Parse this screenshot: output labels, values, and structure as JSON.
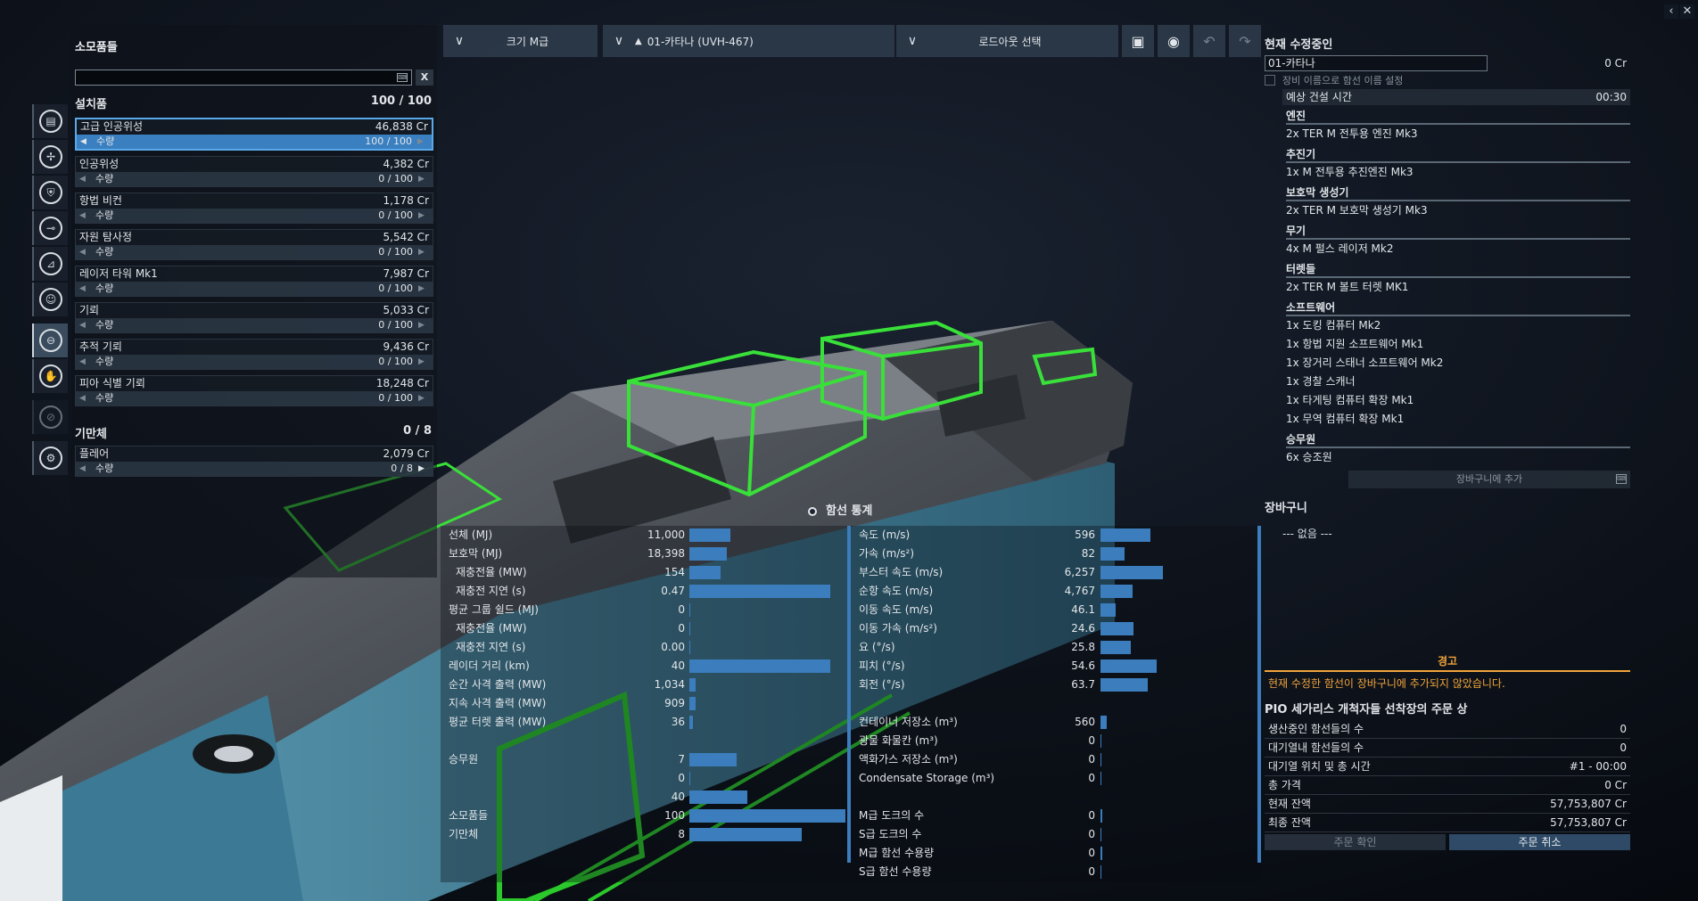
{
  "window": {
    "minimize_icon": "chevron-left-icon",
    "close_icon": "close-icon"
  },
  "topbar": {
    "size_label": "크기 M급",
    "ship_label": "01-카타나 (UVH-467)",
    "loadout_label": "로드아웃 선택",
    "icons": [
      "save-icon",
      "preview-eye-icon",
      "undo-icon",
      "redo-icon"
    ]
  },
  "sidebar": {
    "icons": [
      "deployables-icon",
      "engines-icon",
      "shields-icon",
      "weapons-icon",
      "turrets-icon",
      "crew-icon",
      "consumables-icon",
      "paint-icon",
      "disabled-icon",
      "settings-icon"
    ],
    "active_index": 6
  },
  "left": {
    "title": "소모품들",
    "search_placeholder": "",
    "clear_label": "X",
    "installed": {
      "label": "설치품",
      "count": "100 / 100"
    },
    "qty_label": "수량",
    "items": [
      {
        "name": "고급 인공위성",
        "price": "46,838 Cr",
        "qty": "100 / 100",
        "selected": true
      },
      {
        "name": "인공위성",
        "price": "4,382 Cr",
        "qty": "0 / 100"
      },
      {
        "name": "항법 비컨",
        "price": "1,178 Cr",
        "qty": "0 / 100"
      },
      {
        "name": "자원 탐사정",
        "price": "5,542 Cr",
        "qty": "0 / 100"
      },
      {
        "name": "레이저 타워 Mk1",
        "price": "7,987 Cr",
        "qty": "0 / 100"
      },
      {
        "name": "기뢰",
        "price": "5,033 Cr",
        "qty": "0 / 100"
      },
      {
        "name": "추적 기뢰",
        "price": "9,436 Cr",
        "qty": "0 / 100"
      },
      {
        "name": "피아 식별 기뢰",
        "price": "18,248 Cr",
        "qty": "0 / 100"
      }
    ],
    "countermeasures": {
      "label": "기만체",
      "count": "0 / 8",
      "item": {
        "name": "플레어",
        "price": "2,079 Cr",
        "qty": "0 / 8"
      }
    }
  },
  "right": {
    "editing_title": "현재 수정중인",
    "ship_name": "01-카타나",
    "ship_cost": "0 Cr",
    "name_checkbox_label": "장비 이름으로 함선 이름 설정",
    "build_time_label": "예상 건설 시간",
    "build_time": "00:30",
    "categories": [
      {
        "name": "엔진",
        "items": [
          "2x TER M 전투용 엔진 Mk3"
        ]
      },
      {
        "name": "추진기",
        "items": [
          "1x M 전투용 추진엔진 Mk3"
        ]
      },
      {
        "name": "보호막 생성기",
        "items": [
          "2x TER M 보호막 생성기 Mk3"
        ]
      },
      {
        "name": "무기",
        "items": [
          "4x M 펄스 레이저 Mk2"
        ]
      },
      {
        "name": "터렛들",
        "items": [
          "2x TER M 볼트 터렛 MK1"
        ]
      },
      {
        "name": "소프트웨어",
        "items": [
          "1x 도킹 컴퓨터 Mk2",
          "1x 항법 지원 소프트웨어 Mk1",
          "1x 장거리 스태너 소프트웨어 Mk2",
          "1x 경찰 스캐너",
          "1x 타게팅 컴퓨터 확장 Mk1",
          "1x 무역 컴퓨터 확장 Mk1"
        ]
      },
      {
        "name": "승무원",
        "items": [
          "6x 승조원"
        ]
      }
    ],
    "add_to_cart": "장바구니에 추가",
    "cart_title": "장바구니",
    "cart_empty": "--- 없음 ---",
    "warning_title": "경고",
    "warning_text": "현재 수정한 함선이 장바구니에 추가되지 않았습니다.",
    "order_title": "PIO 세가리스 개척자들 선착장의 주문 상",
    "order_rows": [
      {
        "label": "생산중인 함선들의 수",
        "value": "0"
      },
      {
        "label": "대기열내 함선들의 수",
        "value": "0"
      },
      {
        "label": "대기열 위치 및 총 시간",
        "value": "#1 - 00:00"
      },
      {
        "label": "총 가격",
        "value": "0 Cr"
      },
      {
        "label": "현재 잔액",
        "value": "57,753,807 Cr"
      },
      {
        "label": "최종 잔액",
        "value": "57,753,807 Cr"
      }
    ],
    "confirm_label": "주문 확인",
    "cancel_label": "주문 취소"
  },
  "stats": {
    "title": "함선 통계",
    "left": [
      {
        "label": "선체 (MJ)",
        "value": "11,000",
        "fill": 0.26
      },
      {
        "label": "보호막 (MJ)",
        "value": "18,398",
        "fill": 0.24
      },
      {
        "label": "재충전율 (MW)",
        "value": "154",
        "fill": 0.2,
        "indent": true
      },
      {
        "label": "재충전 지연 (s)",
        "value": "0.47",
        "fill": 0.9,
        "indent": true
      },
      {
        "label": "평균 그룹 쉴드 (MJ)",
        "value": "0",
        "fill": 0
      },
      {
        "label": "재충전율 (MW)",
        "value": "0",
        "fill": 0,
        "indent": true
      },
      {
        "label": "재충전 지연 (s)",
        "value": "0.00",
        "fill": 0,
        "indent": true
      },
      {
        "label": "레이더 거리 (km)",
        "value": "40",
        "fill": 0.9
      },
      {
        "label": "순간 사격 출력 (MW)",
        "value": "1,034",
        "fill": 0.04
      },
      {
        "label": "지속 사격 출력 (MW)",
        "value": "909",
        "fill": 0.04
      },
      {
        "label": "평균 터렛 출력 (MW)",
        "value": "36",
        "fill": 0.02
      },
      {
        "label": "",
        "value": "",
        "fill": null
      },
      {
        "label": "승무원",
        "value": "7",
        "fill": 0.3
      },
      {
        "label": "",
        "value": "0",
        "fill": 0
      },
      {
        "label": "",
        "value": "40",
        "fill": 0.37
      },
      {
        "label": "소모품들",
        "value": "100",
        "fill": 1.0
      },
      {
        "label": "기만체",
        "value": "8",
        "fill": 0.72
      }
    ],
    "right": [
      {
        "label": "속도 (m/s)",
        "value": "596",
        "fill": 0.33
      },
      {
        "label": "가속 (m/s²)",
        "value": "82",
        "fill": 0.16
      },
      {
        "label": "부스터 속도 (m/s)",
        "value": "6,257",
        "fill": 0.41
      },
      {
        "label": "순항 속도 (m/s)",
        "value": "4,767",
        "fill": 0.21
      },
      {
        "label": "이동 속도 (m/s)",
        "value": "46.1",
        "fill": 0.1
      },
      {
        "label": "이동 가속 (m/s²)",
        "value": "24.6",
        "fill": 0.22
      },
      {
        "label": "요 (°/s)",
        "value": "25.8",
        "fill": 0.2
      },
      {
        "label": "피치 (°/s)",
        "value": "54.6",
        "fill": 0.37
      },
      {
        "label": "회전 (°/s)",
        "value": "63.7",
        "fill": 0.31
      },
      {
        "label": "",
        "value": "",
        "fill": null
      },
      {
        "label": "컨테이너 저장소 (m³)",
        "value": "560",
        "fill": 0.04
      },
      {
        "label": "광물 화물칸 (m³)",
        "value": "0",
        "fill": 0
      },
      {
        "label": "액화가스 저장소 (m³)",
        "value": "0",
        "fill": 0
      },
      {
        "label": "Condensate Storage (m³)",
        "value": "0",
        "fill": 0
      },
      {
        "label": "",
        "value": "",
        "fill": null
      },
      {
        "label": "M급 도크의 수",
        "value": "0",
        "fill": 0.01
      },
      {
        "label": "S급 도크의 수",
        "value": "0",
        "fill": 0
      },
      {
        "label": "M급 함선 수용량",
        "value": "0",
        "fill": 0.01
      },
      {
        "label": "S급 함선 수용량",
        "value": "0",
        "fill": 0
      }
    ]
  }
}
